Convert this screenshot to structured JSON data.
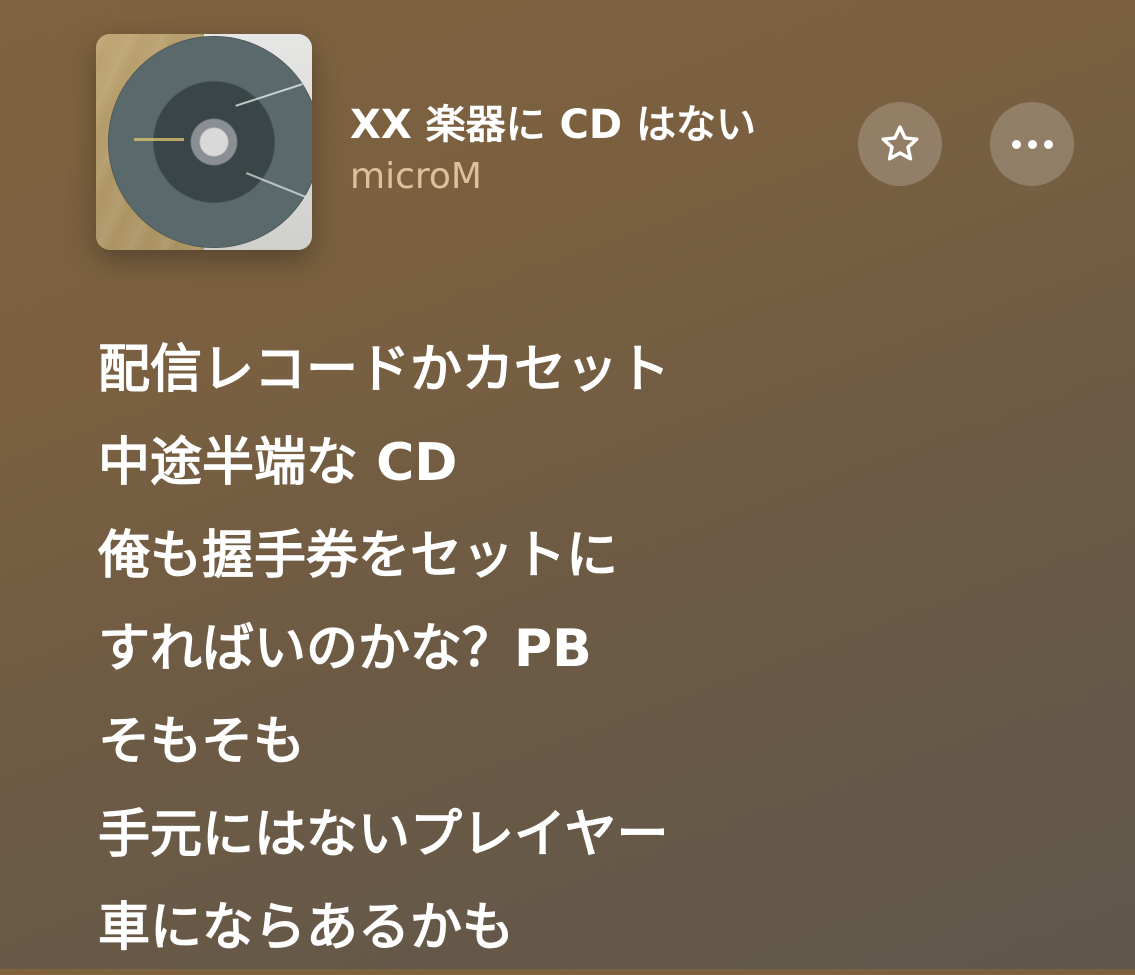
{
  "now_playing": {
    "title": "XX 楽器に CD はない",
    "artist": "microM",
    "favorite_icon": "star-outline-icon",
    "more_icon": "ellipsis-icon"
  },
  "lyrics": [
    "配信レコードかカセット",
    "中途半端な CD",
    "俺も握手券をセットに",
    "すればいのかな？PB",
    "そもそも",
    "手元にはないプレイヤー",
    "車にならあるかも"
  ],
  "colors": {
    "background_top": "#7f633f",
    "background_bottom": "#5f574c",
    "artist_text": "#e8d2b0",
    "button_bg": "rgba(255,255,255,0.20)"
  }
}
